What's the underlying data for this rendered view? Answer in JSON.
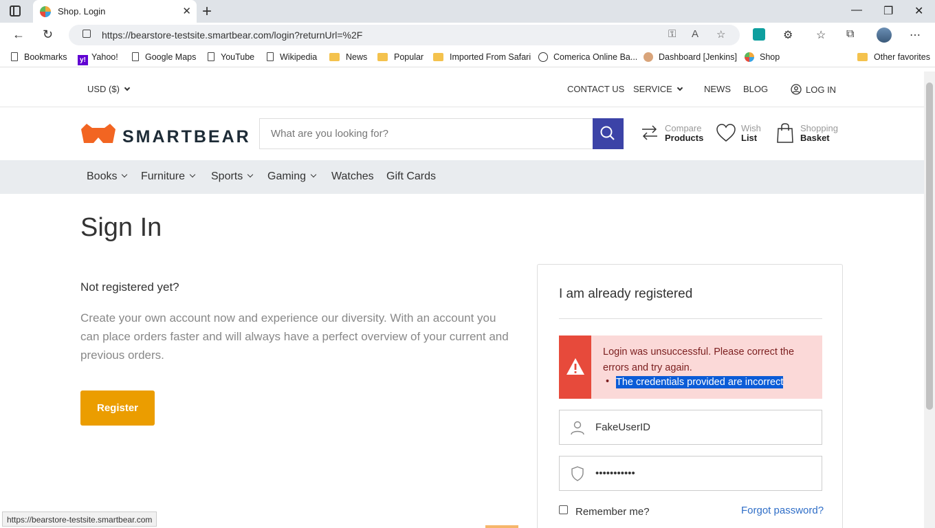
{
  "browser": {
    "tab_title": "Shop. Login",
    "url": "https://bearstore-testsite.smartbear.com/login?returnUrl=%2F",
    "status_url": "https://bearstore-testsite.smartbear.com",
    "bookmarks": [
      "Bookmarks",
      "Yahoo!",
      "Google Maps",
      "YouTube",
      "Wikipedia",
      "News",
      "Popular",
      "Imported From Safari",
      "Comerica Online Ba...",
      "Dashboard [Jenkins]",
      "Shop",
      "Other favorites"
    ]
  },
  "topbar": {
    "currency": "USD  ($)",
    "contact": "CONTACT US",
    "service": "SERVICE",
    "news": "NEWS",
    "blog": "BLOG",
    "login": "LOG IN"
  },
  "header": {
    "logo": "SMARTBEAR",
    "search_placeholder": "What are you looking for?",
    "compare_l1": "Compare",
    "compare_l2": "Products",
    "wish_l1": "Wish",
    "wish_l2": "List",
    "basket_l1": "Shopping",
    "basket_l2": "Basket"
  },
  "categories": [
    "Books",
    "Furniture",
    "Sports",
    "Gaming",
    "Watches",
    "Gift Cards"
  ],
  "main": {
    "title": "Sign In",
    "not_registered": "Not registered yet?",
    "register_text": "Create your own account now and experience our diversity. With an account you can place orders faster and will always have a perfect overview of your current and previous orders.",
    "register_button": "Register"
  },
  "login": {
    "heading": "I am already registered",
    "error_message": "Login was unsuccessful. Please correct the errors and try again.",
    "error_detail": "The credentials provided are incorrect",
    "username_value": "FakeUserID",
    "password_value": "•••••••••••",
    "remember_label": "Remember me?",
    "forgot_link": "Forgot password?"
  },
  "colors": {
    "accent": "#3c43a7",
    "register": "#eb9d00",
    "alert_bg": "#fbd9d8",
    "alert_side": "#e74a3b",
    "link": "#2f6ec7"
  }
}
